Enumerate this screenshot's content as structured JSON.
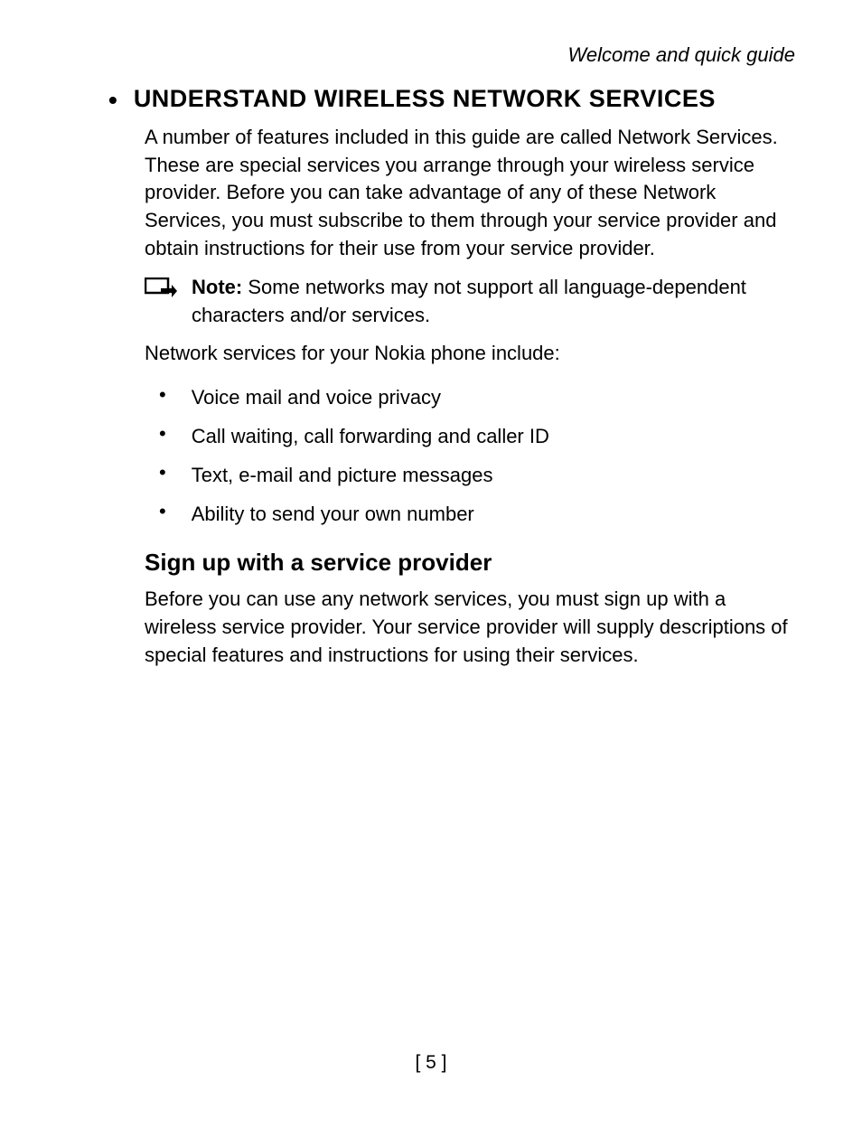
{
  "header": {
    "running_title": "Welcome and quick guide"
  },
  "section": {
    "heading": "UNDERSTAND WIRELESS NETWORK SERVICES",
    "intro": "A number of features included in this guide are called Network Services. These are special services you arrange through your wireless service provider. Before you can take advantage of any of these Network Services, you must subscribe to them through your service provider and obtain instructions for their use from your service provider.",
    "note": {
      "label": "Note:",
      "text": "Some networks may not support all language-dependent characters and/or services."
    },
    "list_intro": "Network services for your Nokia phone include:",
    "items": [
      "Voice mail and voice privacy",
      "Call waiting, call forwarding and caller ID",
      "Text, e-mail and picture messages",
      "Ability to send your own number"
    ],
    "subsection": {
      "heading": "Sign up with a service provider",
      "body": "Before you can use any network services, you must sign up with a wireless service provider. Your service provider will supply descriptions of special features and instructions for using their services."
    }
  },
  "page_number": "[ 5 ]"
}
